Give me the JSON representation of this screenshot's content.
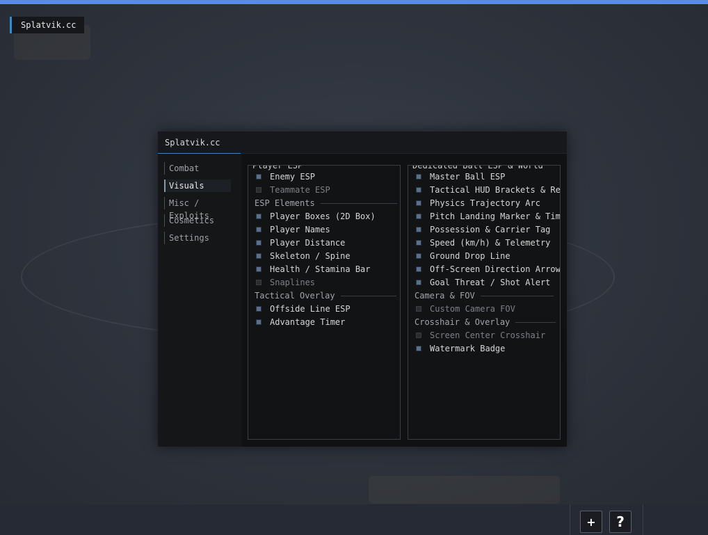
{
  "watermark": "Splatvik.cc",
  "menu": {
    "title": "Splatvik.cc",
    "tabs": [
      {
        "label": "Combat",
        "active": false
      },
      {
        "label": "Visuals",
        "active": true
      },
      {
        "label": "Misc / Exploits",
        "active": false
      },
      {
        "label": "Cosmetics",
        "active": false
      },
      {
        "label": "Settings",
        "active": false
      }
    ],
    "left": {
      "group_title": "Player ESP",
      "player_esp": [
        {
          "label": "Enemy ESP",
          "checked": true
        },
        {
          "label": "Teammate ESP",
          "checked": false
        }
      ],
      "esp_elements_title": "ESP Elements",
      "esp_elements": [
        {
          "label": "Player Boxes (2D Box)",
          "checked": true
        },
        {
          "label": "Player Names",
          "checked": true
        },
        {
          "label": "Player Distance",
          "checked": true
        },
        {
          "label": "Skeleton / Spine",
          "checked": true
        },
        {
          "label": "Health / Stamina Bar",
          "checked": true
        },
        {
          "label": "Snaplines",
          "checked": false
        }
      ],
      "tactical_title": "Tactical Overlay",
      "tactical": [
        {
          "label": "Offside Line ESP",
          "checked": true
        },
        {
          "label": "Advantage Timer",
          "checked": true
        }
      ]
    },
    "right": {
      "group_title": "Dedicated Ball ESP & World",
      "ball": [
        {
          "label": "Master Ball ESP",
          "checked": true
        },
        {
          "label": "Tactical HUD Brackets & Ret",
          "checked": true
        },
        {
          "label": "Physics Trajectory Arc",
          "checked": true
        },
        {
          "label": "Pitch Landing Marker & Time",
          "checked": true
        },
        {
          "label": "Possession & Carrier Tag",
          "checked": true
        },
        {
          "label": "Speed (km/h) & Telemetry",
          "checked": true
        },
        {
          "label": "Ground Drop Line",
          "checked": true
        },
        {
          "label": "Off-Screen Direction Arrow",
          "checked": true
        },
        {
          "label": "Goal Threat / Shot Alert",
          "checked": true
        }
      ],
      "camera_title": "Camera & FOV",
      "camera": [
        {
          "label": "Custom Camera FOV",
          "checked": false
        }
      ],
      "crosshair_title": "Crosshair & Overlay",
      "crosshair": [
        {
          "label": "Screen Center Crosshair",
          "checked": false
        },
        {
          "label": "Watermark Badge",
          "checked": true
        }
      ]
    }
  },
  "bottombar": {
    "add_label": "+",
    "help_label": "?"
  },
  "colors": {
    "accent": "#2f8fd6",
    "checkbox_on": "#5b6e8c",
    "checkbox_off": "#2b2d31",
    "topbar": "#5a8de0"
  }
}
